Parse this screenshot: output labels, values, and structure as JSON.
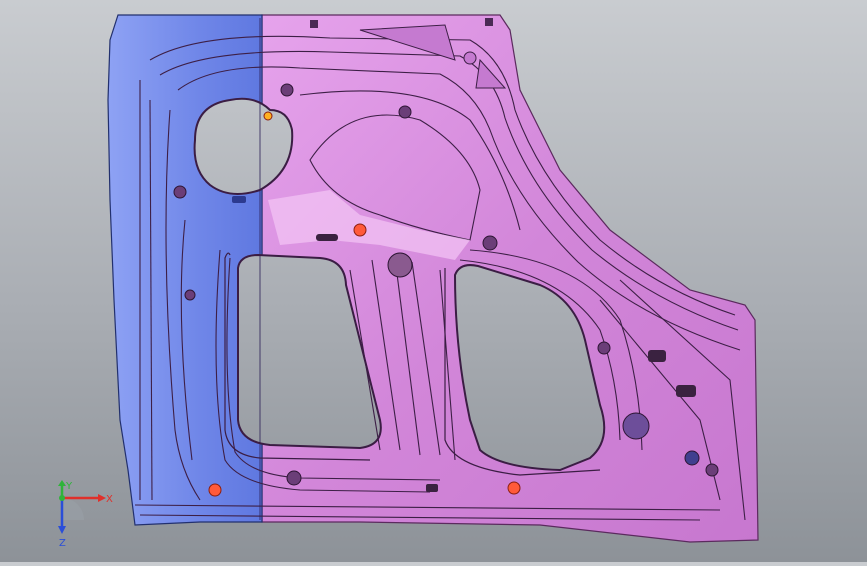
{
  "scene": {
    "model_colors": {
      "left_part": "#6f86e8",
      "right_part": "#d98be0",
      "background_top": "#c9ccd0",
      "background_bottom": "#8d9298"
    }
  },
  "triad": {
    "x_label": "X",
    "y_label": "Y",
    "z_label": "Z",
    "colors": {
      "x": "#e0302a",
      "y": "#2fb33a",
      "z": "#2a4ed8"
    }
  }
}
